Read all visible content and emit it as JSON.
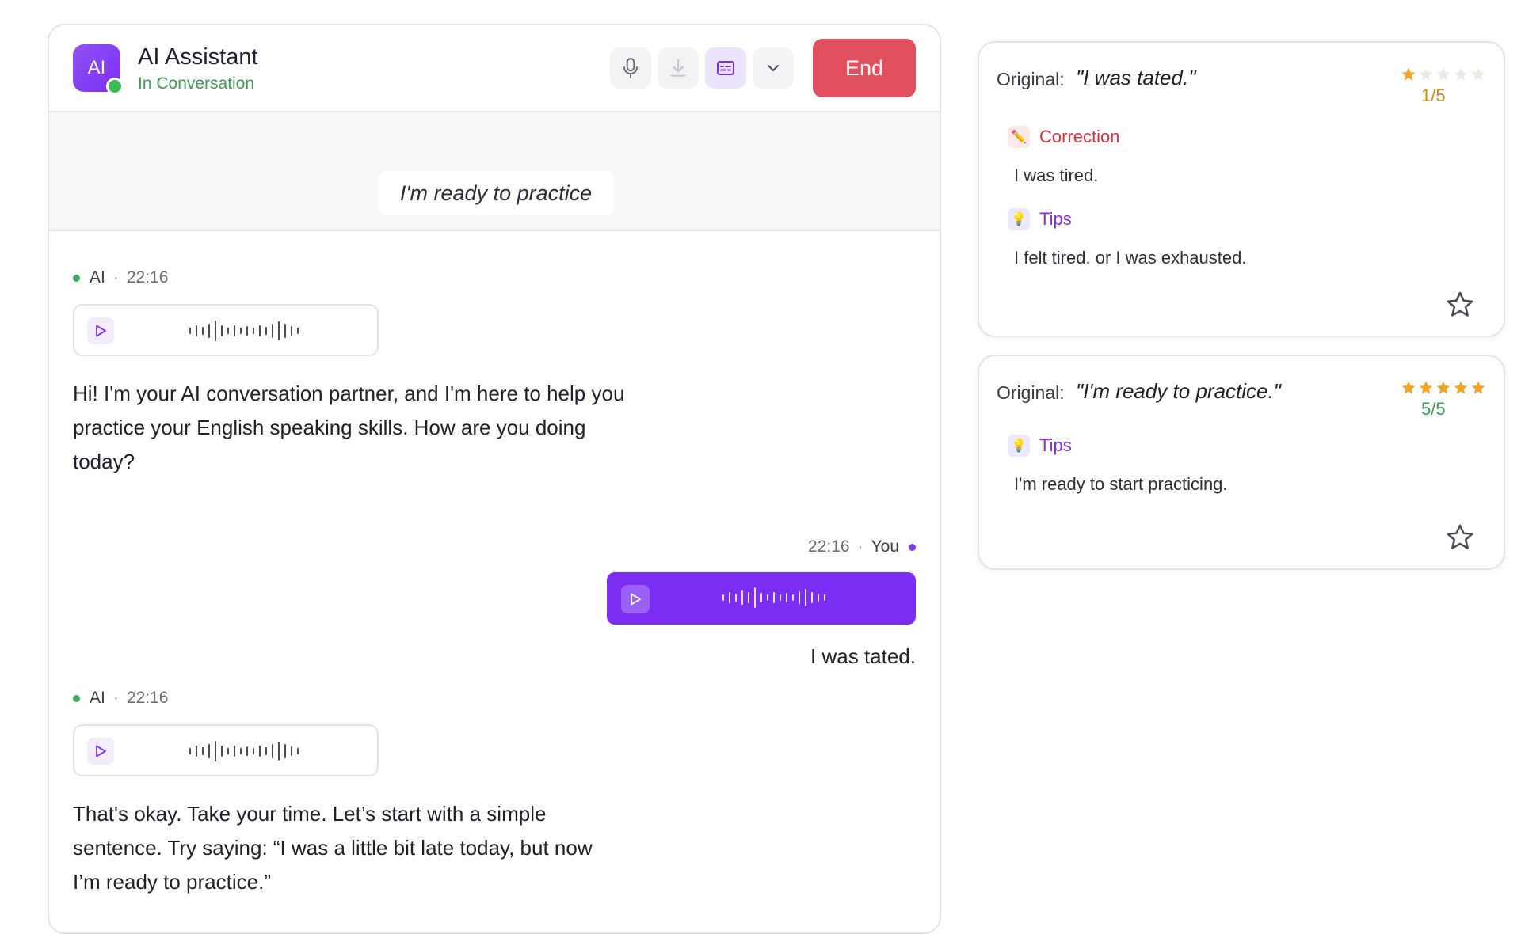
{
  "header": {
    "avatar_text": "AI",
    "title": "AI Assistant",
    "status": "In Conversation",
    "end_label": "End",
    "tools": [
      "microphone-icon",
      "download-icon",
      "subtitles-icon",
      "chevron-down-icon"
    ]
  },
  "live": {
    "transcript": "I'm ready to practice"
  },
  "messages": [
    {
      "sender": "AI",
      "time": "22:16",
      "text": "Hi! I'm your AI conversation partner, and I'm here to help you practice your English speaking skills. How are you doing today?"
    },
    {
      "sender": "You",
      "time": "22:16",
      "text": "I was tated."
    },
    {
      "sender": "AI",
      "time": "22:16",
      "text": "That's okay. Take your time. Let’s start with a simple sentence. Try saying: “I was a little bit late today, but now I’m ready to practice.”"
    }
  ],
  "feedback": [
    {
      "original_label": "Original:",
      "original": "\"I was tated.\"",
      "rating": 1,
      "rating_max": 5,
      "rating_text": "1/5",
      "correction_label": "Correction",
      "correction": "I was tired.",
      "tips_label": "Tips",
      "tips": "I felt tired. or I was exhausted."
    },
    {
      "original_label": "Original:",
      "original": "\"I'm ready to practice.\"",
      "rating": 5,
      "rating_max": 5,
      "rating_text": "5/5",
      "tips_label": "Tips",
      "tips": "I'm ready to start practicing."
    }
  ],
  "colors": {
    "accent": "#7c2df3",
    "end": "#e0505e",
    "online": "#3dba57",
    "star": "#f0a623",
    "correction": "#d8323f",
    "tips": "#8a2be2"
  }
}
